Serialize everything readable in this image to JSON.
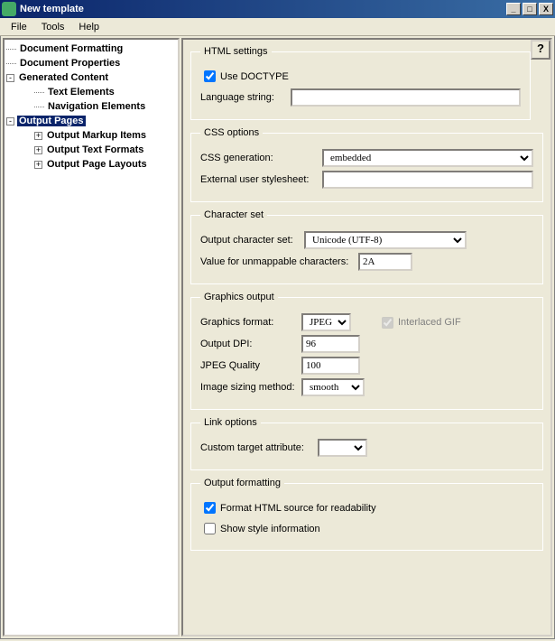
{
  "window": {
    "title": "New template",
    "minimize": "_",
    "maximize": "□",
    "close": "X"
  },
  "menu": {
    "file": "File",
    "tools": "Tools",
    "help": "Help"
  },
  "tree": {
    "doc_formatting": "Document Formatting",
    "doc_properties": "Document Properties",
    "gen_content": "Generated Content",
    "text_elements": "Text Elements",
    "nav_elements": "Navigation Elements",
    "output_pages": "Output Pages",
    "markup_items": "Output Markup Items",
    "text_formats": "Output Text Formats",
    "page_layouts": "Output Page Layouts"
  },
  "help_btn": "?",
  "html": {
    "legend": "HTML settings",
    "use_doctype_label": "Use DOCTYPE",
    "use_doctype_checked": true,
    "lang_label": "Language string:",
    "lang_value": ""
  },
  "css": {
    "legend": "CSS options",
    "gen_label": "CSS generation:",
    "gen_value": "embedded",
    "ext_label": "External user stylesheet:",
    "ext_value": ""
  },
  "charset": {
    "legend": "Character set",
    "out_label": "Output character set:",
    "out_value": "Unicode (UTF-8)",
    "unmap_label": "Value for unmappable characters:",
    "unmap_value": "2A"
  },
  "graphics": {
    "legend": "Graphics output",
    "fmt_label": "Graphics format:",
    "fmt_value": "JPEG",
    "interlaced_label": "Interlaced GIF",
    "dpi_label": "Output DPI:",
    "dpi_value": "96",
    "jpeg_label": "JPEG Quality",
    "jpeg_value": "100",
    "sizing_label": "Image sizing method:",
    "sizing_value": "smooth"
  },
  "link": {
    "legend": "Link options",
    "target_label": "Custom target attribute:",
    "target_value": ""
  },
  "outfmt": {
    "legend": "Output formatting",
    "readability_label": "Format HTML source for readability",
    "readability_checked": true,
    "styleinfo_label": "Show style information",
    "styleinfo_checked": false
  }
}
